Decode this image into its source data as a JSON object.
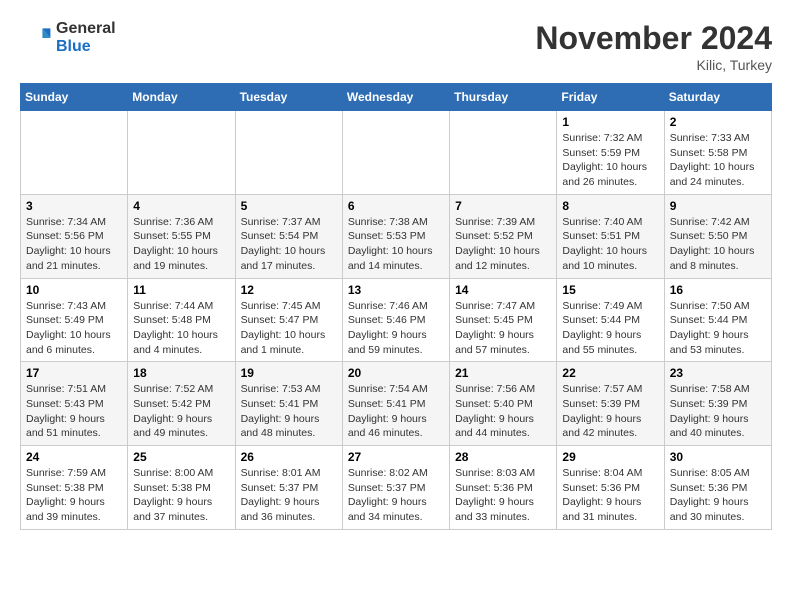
{
  "header": {
    "logo_general": "General",
    "logo_blue": "Blue",
    "month_title": "November 2024",
    "location": "Kilic, Turkey"
  },
  "weekdays": [
    "Sunday",
    "Monday",
    "Tuesday",
    "Wednesday",
    "Thursday",
    "Friday",
    "Saturday"
  ],
  "weeks": [
    [
      {
        "day": "",
        "info": ""
      },
      {
        "day": "",
        "info": ""
      },
      {
        "day": "",
        "info": ""
      },
      {
        "day": "",
        "info": ""
      },
      {
        "day": "",
        "info": ""
      },
      {
        "day": "1",
        "info": "Sunrise: 7:32 AM\nSunset: 5:59 PM\nDaylight: 10 hours and 26 minutes."
      },
      {
        "day": "2",
        "info": "Sunrise: 7:33 AM\nSunset: 5:58 PM\nDaylight: 10 hours and 24 minutes."
      }
    ],
    [
      {
        "day": "3",
        "info": "Sunrise: 7:34 AM\nSunset: 5:56 PM\nDaylight: 10 hours and 21 minutes."
      },
      {
        "day": "4",
        "info": "Sunrise: 7:36 AM\nSunset: 5:55 PM\nDaylight: 10 hours and 19 minutes."
      },
      {
        "day": "5",
        "info": "Sunrise: 7:37 AM\nSunset: 5:54 PM\nDaylight: 10 hours and 17 minutes."
      },
      {
        "day": "6",
        "info": "Sunrise: 7:38 AM\nSunset: 5:53 PM\nDaylight: 10 hours and 14 minutes."
      },
      {
        "day": "7",
        "info": "Sunrise: 7:39 AM\nSunset: 5:52 PM\nDaylight: 10 hours and 12 minutes."
      },
      {
        "day": "8",
        "info": "Sunrise: 7:40 AM\nSunset: 5:51 PM\nDaylight: 10 hours and 10 minutes."
      },
      {
        "day": "9",
        "info": "Sunrise: 7:42 AM\nSunset: 5:50 PM\nDaylight: 10 hours and 8 minutes."
      }
    ],
    [
      {
        "day": "10",
        "info": "Sunrise: 7:43 AM\nSunset: 5:49 PM\nDaylight: 10 hours and 6 minutes."
      },
      {
        "day": "11",
        "info": "Sunrise: 7:44 AM\nSunset: 5:48 PM\nDaylight: 10 hours and 4 minutes."
      },
      {
        "day": "12",
        "info": "Sunrise: 7:45 AM\nSunset: 5:47 PM\nDaylight: 10 hours and 1 minute."
      },
      {
        "day": "13",
        "info": "Sunrise: 7:46 AM\nSunset: 5:46 PM\nDaylight: 9 hours and 59 minutes."
      },
      {
        "day": "14",
        "info": "Sunrise: 7:47 AM\nSunset: 5:45 PM\nDaylight: 9 hours and 57 minutes."
      },
      {
        "day": "15",
        "info": "Sunrise: 7:49 AM\nSunset: 5:44 PM\nDaylight: 9 hours and 55 minutes."
      },
      {
        "day": "16",
        "info": "Sunrise: 7:50 AM\nSunset: 5:44 PM\nDaylight: 9 hours and 53 minutes."
      }
    ],
    [
      {
        "day": "17",
        "info": "Sunrise: 7:51 AM\nSunset: 5:43 PM\nDaylight: 9 hours and 51 minutes."
      },
      {
        "day": "18",
        "info": "Sunrise: 7:52 AM\nSunset: 5:42 PM\nDaylight: 9 hours and 49 minutes."
      },
      {
        "day": "19",
        "info": "Sunrise: 7:53 AM\nSunset: 5:41 PM\nDaylight: 9 hours and 48 minutes."
      },
      {
        "day": "20",
        "info": "Sunrise: 7:54 AM\nSunset: 5:41 PM\nDaylight: 9 hours and 46 minutes."
      },
      {
        "day": "21",
        "info": "Sunrise: 7:56 AM\nSunset: 5:40 PM\nDaylight: 9 hours and 44 minutes."
      },
      {
        "day": "22",
        "info": "Sunrise: 7:57 AM\nSunset: 5:39 PM\nDaylight: 9 hours and 42 minutes."
      },
      {
        "day": "23",
        "info": "Sunrise: 7:58 AM\nSunset: 5:39 PM\nDaylight: 9 hours and 40 minutes."
      }
    ],
    [
      {
        "day": "24",
        "info": "Sunrise: 7:59 AM\nSunset: 5:38 PM\nDaylight: 9 hours and 39 minutes."
      },
      {
        "day": "25",
        "info": "Sunrise: 8:00 AM\nSunset: 5:38 PM\nDaylight: 9 hours and 37 minutes."
      },
      {
        "day": "26",
        "info": "Sunrise: 8:01 AM\nSunset: 5:37 PM\nDaylight: 9 hours and 36 minutes."
      },
      {
        "day": "27",
        "info": "Sunrise: 8:02 AM\nSunset: 5:37 PM\nDaylight: 9 hours and 34 minutes."
      },
      {
        "day": "28",
        "info": "Sunrise: 8:03 AM\nSunset: 5:36 PM\nDaylight: 9 hours and 33 minutes."
      },
      {
        "day": "29",
        "info": "Sunrise: 8:04 AM\nSunset: 5:36 PM\nDaylight: 9 hours and 31 minutes."
      },
      {
        "day": "30",
        "info": "Sunrise: 8:05 AM\nSunset: 5:36 PM\nDaylight: 9 hours and 30 minutes."
      }
    ]
  ]
}
